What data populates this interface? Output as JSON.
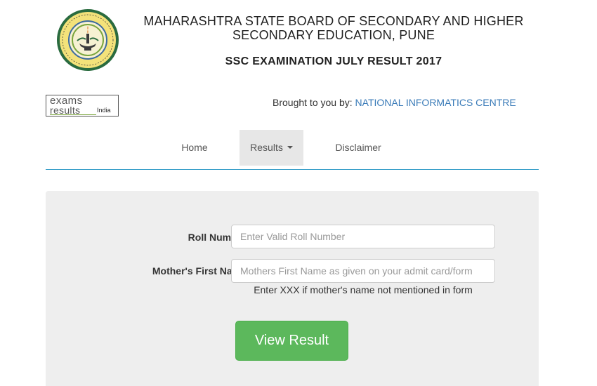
{
  "header": {
    "board_line1": "MAHARASHTRA STATE BOARD OF SECONDARY AND HIGHER",
    "board_line2": "SECONDARY EDUCATION, PUNE",
    "exam_title": "SSC EXAMINATION JULY RESULT 2017",
    "seal_icon": "maharashtra-board-seal-icon"
  },
  "brand": {
    "logo_line1": "exams",
    "logo_line2": "results",
    "logo_line3": "India",
    "brought_prefix": "Brought to you by: ",
    "brought_org": "NATIONAL INFORMATICS CENTRE"
  },
  "nav": {
    "home": "Home",
    "results": "Results",
    "disclaimer": "Disclaimer"
  },
  "form": {
    "roll_label": "Roll Number:*",
    "roll_placeholder": "Enter Valid Roll Number",
    "roll_value": "",
    "mother_label": "Mother's First Name:*",
    "mother_placeholder": "Mothers First Name as given on your admit card/form",
    "mother_value": "",
    "help_text": "Enter XXX if mother's name not mentioned in form",
    "submit_label": "View Result"
  },
  "colors": {
    "link": "#3a7bb8",
    "nav_active_bg": "#e7e7e7",
    "nav_border": "#3aa0c9",
    "panel_bg": "#eeeeee",
    "button_bg": "#5cb85c"
  }
}
